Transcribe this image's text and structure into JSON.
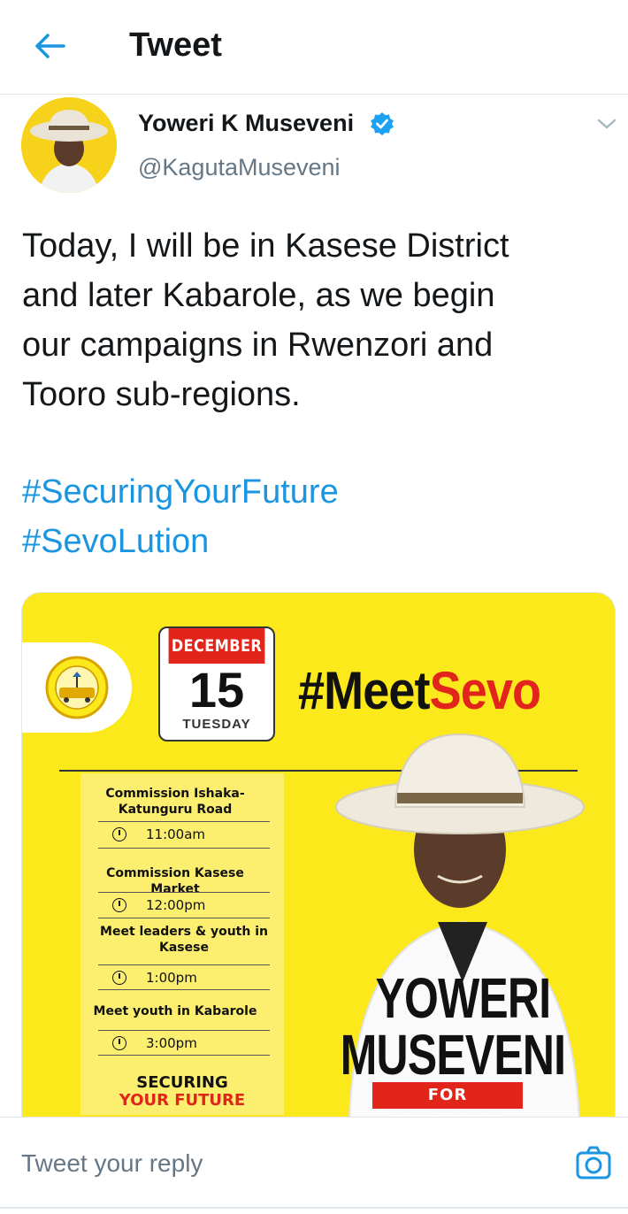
{
  "header": {
    "title": "Tweet",
    "back_icon": "arrow-left-icon"
  },
  "tweet": {
    "author_name": "Yoweri K Museveni",
    "handle": "@KagutaMuseveni",
    "verified": true,
    "text_lines": [
      "Today, I will be in Kasese District",
      "and later Kabarole, as we begin",
      "our campaigns in Rwenzori and",
      "Tooro sub-regions."
    ],
    "hashtags": [
      "#SecuringYourFuture",
      "#SevoLution"
    ]
  },
  "poster": {
    "calendar_month": "DECEMBER",
    "calendar_day": "15",
    "calendar_weekday": "TUESDAY",
    "headline_black": "#Meet",
    "headline_red": "Sevo",
    "schedule": [
      {
        "event": "Commission Ishaka-Katunguru Road",
        "time": "11:00am"
      },
      {
        "event": "Commission Kasese Market",
        "time": "12:00pm"
      },
      {
        "event": "Meet leaders & youth in Kasese",
        "time": "1:00pm"
      },
      {
        "event": "Meet youth in Kabarole",
        "time": "3:00pm"
      }
    ],
    "slogan_line1": "SECURING",
    "slogan_line2": "YOUR FUTURE",
    "candidate_first": "YOWERI",
    "candidate_last": "MUSEVENI",
    "candidate_tag": "FOR PRESIDENT"
  },
  "reply": {
    "placeholder": "Tweet your reply",
    "camera_icon": "camera-icon"
  },
  "colors": {
    "link_blue": "#1b95e0",
    "poster_yellow": "#fbe91c",
    "accent_red": "#e1251b",
    "text_gray": "#657786"
  }
}
